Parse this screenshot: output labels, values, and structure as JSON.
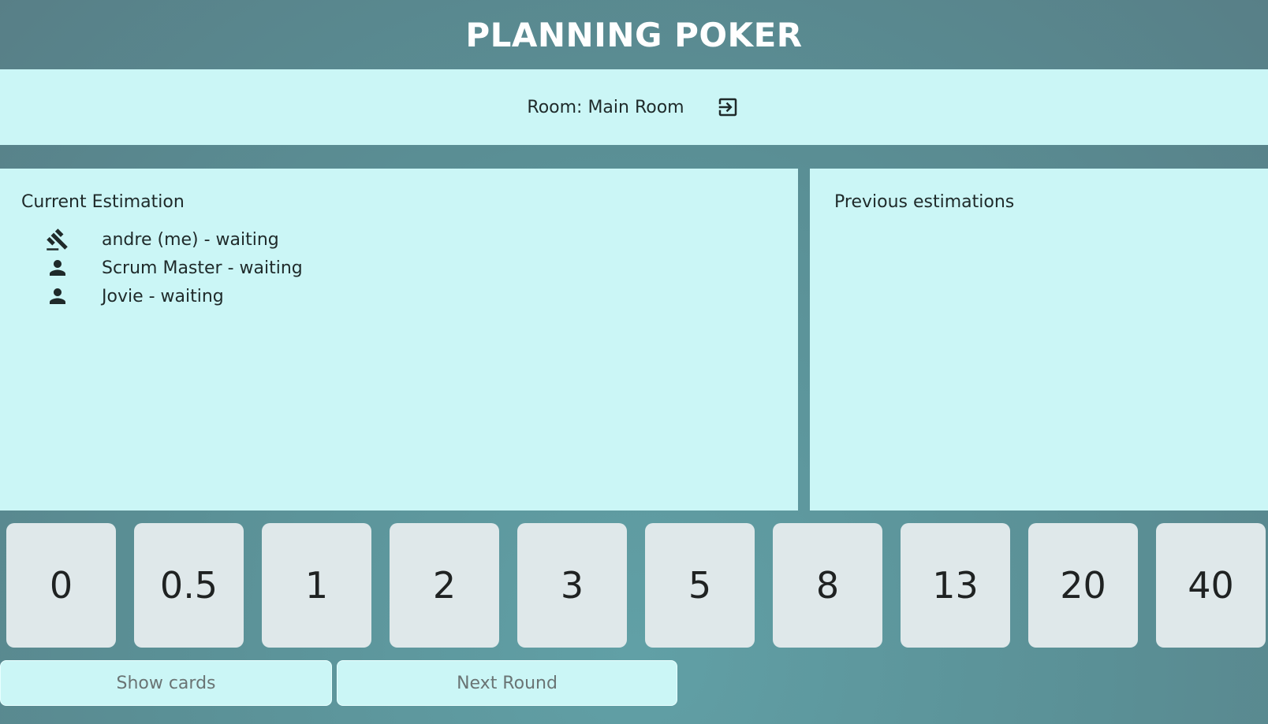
{
  "app": {
    "title": "PLANNING POKER"
  },
  "room": {
    "label": "Room: Main Room",
    "leave_icon": "exit-to-app-icon"
  },
  "current_estimation": {
    "title": "Current Estimation",
    "participants": [
      {
        "icon": "gavel-icon",
        "label": "andre (me) - waiting"
      },
      {
        "icon": "person-icon",
        "label": "Scrum Master - waiting"
      },
      {
        "icon": "person-icon",
        "label": "Jovie - waiting"
      }
    ]
  },
  "previous_estimations": {
    "title": "Previous estimations"
  },
  "cards": [
    "0",
    "0.5",
    "1",
    "2",
    "3",
    "5",
    "8",
    "13",
    "20",
    "40"
  ],
  "actions": {
    "show_cards": "Show cards",
    "next_round": "Next Round"
  },
  "colors": {
    "panel_bg": "#cbf6f6",
    "card_bg": "#dfe8ea",
    "page_bg": "#5a8f95"
  }
}
